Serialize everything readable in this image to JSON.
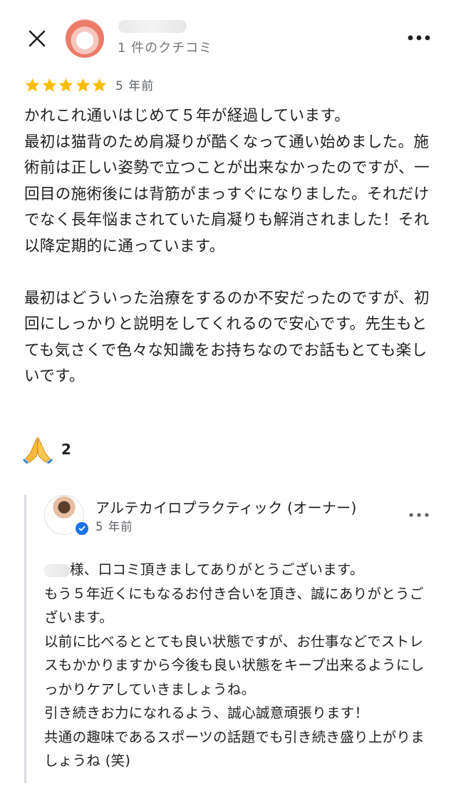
{
  "header": {
    "close_icon": "close-icon",
    "reviewer_review_count": "1 件のクチコミ",
    "more_icon": "more-vert-icon"
  },
  "review": {
    "rating": 5,
    "max_rating": 5,
    "star_color": "#fbbc04",
    "date": "5 年前",
    "paragraphs": [
      "かれこれ通いはじめて５年が経過しています。\n最初は猫背のため肩凝りが酷くなって通い始めました。施術前は正しい姿勢で立つことが出来なかったのですが、一回目の施術後には背筋がまっすぐになりました。それだけでなく長年悩まされていた肩凝りも解消されました！それ以降定期的に通っています。",
      "最初はどういった治療をするのか不安だったのですが、初回にしっかりと説明をしてくれるので安心です。先生もとても気さくで色々な知識をお持ちなのでお話もとても楽しいです。"
    ],
    "reaction": {
      "icon": "folded-hands-icon",
      "count": "2"
    }
  },
  "owner_reply": {
    "name": "アルテカイロプラクティック (オーナー)",
    "date": "5 年前",
    "verified_color": "#1a73e8",
    "lines": [
      "様、口コミ頂きましてありがとうございます。",
      "もう５年近くにもなるお付き合いを頂き、誠にありがとうございます。",
      "以前に比べるととても良い状態ですが、お仕事などでストレスもかかりますから今後も良い状態をキープ出来るようにしっかりケアしていきましょうね。",
      "引き続きお力になれるよう、誠心誠意頑張ります！",
      "共通の趣味であるスポーツの話題でも引き続き盛り上がりましょうね (笑)"
    ]
  }
}
